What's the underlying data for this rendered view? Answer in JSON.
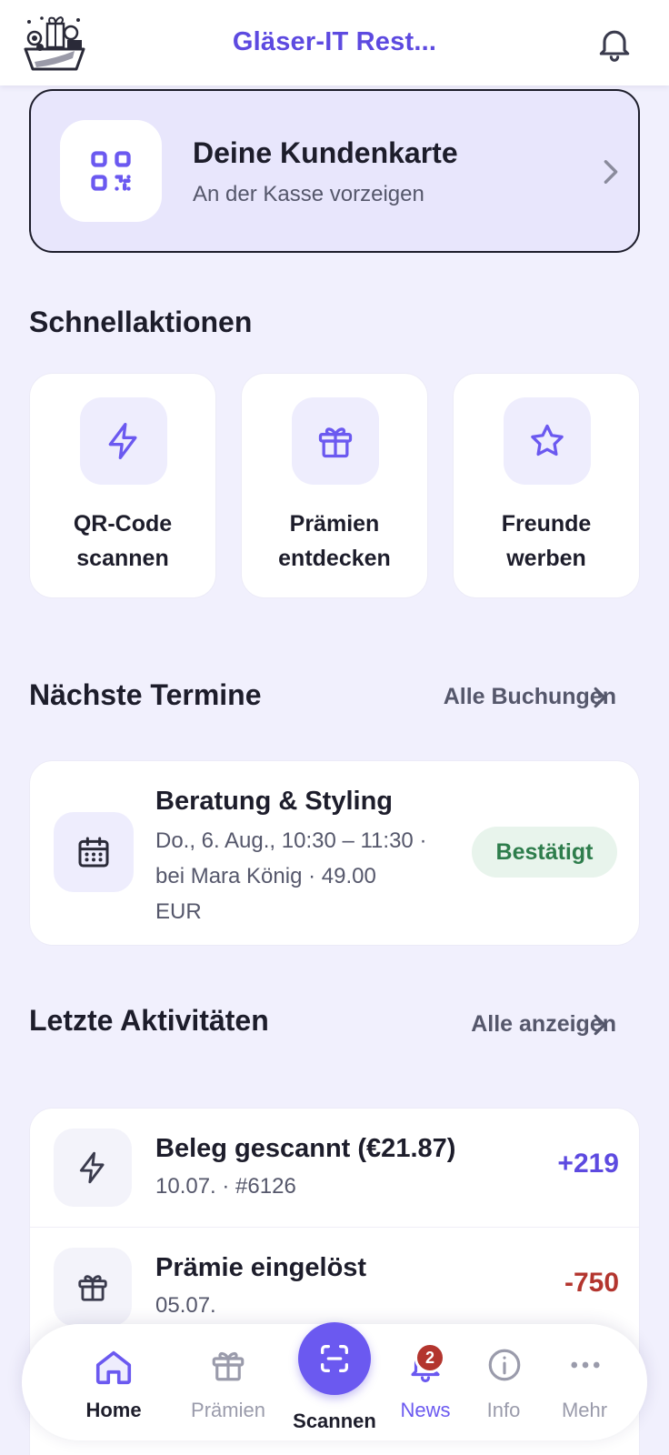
{
  "header": {
    "title": "Gläser-IT Rest...",
    "notification_count": "2"
  },
  "loyalty_card": {
    "title": "Deine Kundenkarte",
    "subtitle": "An der Kasse vorzeigen"
  },
  "quick_actions": {
    "heading": "Schnellaktionen",
    "items": [
      {
        "label": "QR-Code\nscannen",
        "icon": "lightning-icon"
      },
      {
        "label": "Prämien\nentdecken",
        "icon": "gift-icon"
      },
      {
        "label": "Freunde\nwerben",
        "icon": "star-icon"
      }
    ]
  },
  "appointments": {
    "heading": "Nächste Termine",
    "link": "Alle Buchungen",
    "items": [
      {
        "title": "Beratung & Styling",
        "details": "Do., 6. Aug., 10:30 – 11:30 · bei Mara König · 49.00 EUR",
        "status": "Bestätigt"
      }
    ]
  },
  "activities": {
    "heading": "Letzte Aktivitäten",
    "link": "Alle anzeigen",
    "items": [
      {
        "title": "Beleg gescannt (€21.87)",
        "meta": "10.07. · #6126",
        "points": "+219",
        "color": "#5d4ae0"
      },
      {
        "title": "Prämie eingelöst",
        "meta": "05.07.",
        "points": "-750",
        "color": "#b3352e"
      }
    ]
  },
  "bottom_nav": {
    "items": [
      {
        "label": "Home",
        "active": true
      },
      {
        "label": "Prämien",
        "active": false
      },
      {
        "label": "Scannen",
        "active": false
      },
      {
        "label": "News",
        "active": false
      },
      {
        "label": "Info",
        "active": false
      },
      {
        "label": "Mehr",
        "active": false
      }
    ],
    "news_badge": "2"
  },
  "colors": {
    "accent": "#6b59f0",
    "accent_text": "#5d4ae0",
    "success": "#2e7d4c",
    "danger": "#b3352e",
    "background": "#f1f0fd"
  }
}
